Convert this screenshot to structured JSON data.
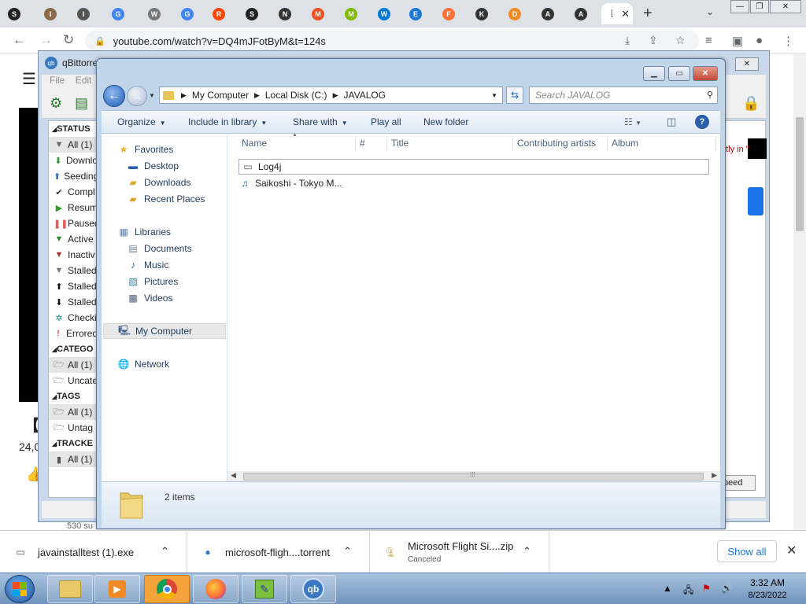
{
  "browser": {
    "tabs": [
      {
        "icon": "threads-icon",
        "letter": "S",
        "color": "#222222"
      },
      {
        "icon": "cookie-icon",
        "letter": "I",
        "color": "#8a6a4a"
      },
      {
        "icon": "circle-icon",
        "letter": "I",
        "color": "#555555"
      },
      {
        "icon": "google-icon",
        "letter": "G",
        "color": "#4285f4"
      },
      {
        "icon": "wiki-icon",
        "letter": "W",
        "color": "#777777"
      },
      {
        "icon": "google-icon",
        "letter": "G",
        "color": "#4285f4"
      },
      {
        "icon": "reddit-icon",
        "letter": "R",
        "color": "#ff4500"
      },
      {
        "icon": "threads-icon",
        "letter": "S",
        "color": "#222222"
      },
      {
        "icon": "nfs-icon",
        "letter": "N",
        "color": "#333333"
      },
      {
        "icon": "microsoft-icon",
        "letter": "M",
        "color": "#f25022"
      },
      {
        "icon": "microsoft-icon",
        "letter": "M",
        "color": "#7fba00"
      },
      {
        "icon": "windows-icon",
        "letter": "W",
        "color": "#0078d7"
      },
      {
        "icon": "edge-icon",
        "letter": "E",
        "color": "#1f7ad6"
      },
      {
        "icon": "firefox-icon",
        "letter": "F",
        "color": "#ff7139"
      },
      {
        "icon": "k-icon",
        "letter": "K",
        "color": "#333333"
      },
      {
        "icon": "diamond-icon",
        "letter": "D",
        "color": "#f08a24"
      },
      {
        "icon": "archive-icon",
        "letter": "A",
        "color": "#333333"
      },
      {
        "icon": "archive-icon",
        "letter": "A",
        "color": "#333333"
      }
    ],
    "url": "youtube.com/watch?v=DQ4mJFotByM&t=124s"
  },
  "youtube": {
    "title_fragment": "【",
    "views_fragment": "24,0",
    "subs_fragment": "530 su"
  },
  "qbittorrent": {
    "title": "qBittorre",
    "menu": [
      "File",
      "Edit"
    ],
    "status_header": "STATUS",
    "status_items": [
      {
        "label": "All (1)",
        "icon": "filter-icon",
        "glyph": "▼",
        "color": "#666"
      },
      {
        "label": "Downlo",
        "icon": "download-arrow-icon",
        "glyph": "⬇",
        "color": "#2e8b2e"
      },
      {
        "label": "Seeding",
        "icon": "upload-arrow-icon",
        "glyph": "⬆",
        "color": "#2b6bd6"
      },
      {
        "label": "Compl",
        "icon": "checkmark-icon",
        "glyph": "✔",
        "color": "#333"
      },
      {
        "label": "Resum",
        "icon": "play-icon",
        "glyph": "▶",
        "color": "#2e9b2e"
      },
      {
        "label": "Paused",
        "icon": "pause-icon",
        "glyph": "❚❚",
        "color": "#e06060"
      },
      {
        "label": "Active",
        "icon": "active-filter-icon",
        "glyph": "▼",
        "color": "#2e8b2e"
      },
      {
        "label": "Inactiv",
        "icon": "inactive-filter-icon",
        "glyph": "▼",
        "color": "#b03030"
      },
      {
        "label": "Stalled",
        "icon": "stalled-filter-icon",
        "glyph": "▼",
        "color": "#777"
      },
      {
        "label": "Stalled",
        "icon": "stalled-upload-icon",
        "glyph": "⬆",
        "color": "#111"
      },
      {
        "label": "Stalled",
        "icon": "stalled-download-icon",
        "glyph": "⬇",
        "color": "#111"
      },
      {
        "label": "Checki",
        "icon": "checking-gear-icon",
        "glyph": "✲",
        "color": "#1a8a8a"
      },
      {
        "label": "Errored",
        "icon": "error-exclamation-icon",
        "glyph": "!",
        "color": "#e00000"
      }
    ],
    "categories_header": "CATEGO",
    "categories": [
      {
        "label": "All (1)",
        "icon": "folder-open-icon"
      },
      {
        "label": "Uncate",
        "icon": "folder-open-icon"
      }
    ],
    "tags_header": "TAGS",
    "tags": [
      {
        "label": "All (1)",
        "icon": "folder-open-icon"
      },
      {
        "label": "Untag",
        "icon": "folder-open-icon"
      }
    ],
    "trackers_header": "TRACKE",
    "trackers": [
      {
        "label": "All (1)",
        "icon": "tracker-icon"
      }
    ],
    "right_text": "ntly in \"",
    "speed_button": "peed"
  },
  "explorer": {
    "address": {
      "crumbs": [
        "My Computer",
        "Local Disk (C:)",
        "JAVALOG"
      ]
    },
    "search_placeholder": "Search JAVALOG",
    "commands": [
      {
        "label": "Organize",
        "dropdown": true
      },
      {
        "label": "Include in library",
        "dropdown": true
      },
      {
        "label": "Share with",
        "dropdown": true
      },
      {
        "label": "Play all",
        "dropdown": false
      },
      {
        "label": "New folder",
        "dropdown": false
      }
    ],
    "nav": {
      "favorites": {
        "label": "Favorites",
        "items": [
          "Desktop",
          "Downloads",
          "Recent Places"
        ]
      },
      "libraries": {
        "label": "Libraries",
        "items": [
          "Documents",
          "Music",
          "Pictures",
          "Videos"
        ]
      },
      "computer": "My Computer",
      "network": "Network"
    },
    "columns": [
      "Name",
      "#",
      "Title",
      "Contributing artists",
      "Album"
    ],
    "files": [
      {
        "name": "Log4j",
        "icon": "text-file-icon"
      },
      {
        "name": "Saikoshi - Tokyo M...",
        "icon": "music-file-icon"
      }
    ],
    "details_count": "2 items"
  },
  "downloads": [
    {
      "name": "javainstalltest (1).exe",
      "status": "",
      "icon": "exe-file-icon"
    },
    {
      "name": "microsoft-fligh....torrent",
      "status": "",
      "icon": "torrent-file-icon"
    },
    {
      "name": "Microsoft Flight Si....zip",
      "status": "Canceled",
      "icon": "zip-file-icon"
    }
  ],
  "show_all": "Show all",
  "taskbar": {
    "time": "3:32 AM",
    "date": "8/23/2022"
  }
}
